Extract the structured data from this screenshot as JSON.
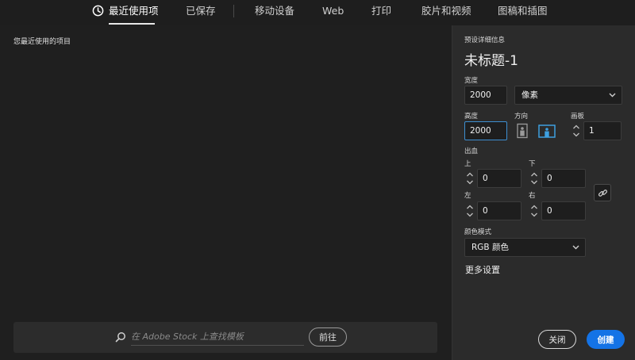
{
  "tabs": [
    {
      "label": "最近使用项",
      "active": true
    },
    {
      "label": "已保存"
    },
    {
      "label": "移动设备"
    },
    {
      "label": "Web"
    },
    {
      "label": "打印"
    },
    {
      "label": "胶片和视频"
    },
    {
      "label": "图稿和插图"
    }
  ],
  "left": {
    "title": "您最近使用的项目",
    "stock_placeholder": "在 Adobe Stock 上查找模板",
    "go_label": "前往"
  },
  "preset": {
    "section_label": "预设详细信息",
    "doc_name": "未标题-1",
    "width_label": "宽度",
    "width_value": "2000",
    "unit_value": "像素",
    "height_label": "高度",
    "height_value": "2000",
    "orientation_label": "方向",
    "artboard_label": "画板",
    "artboard_value": "1",
    "bleed_label": "出血",
    "top_label": "上",
    "top_value": "0",
    "bottom_label": "下",
    "bottom_value": "0",
    "left_label": "左",
    "left_value": "0",
    "right_label": "右",
    "right_value": "0",
    "color_mode_label": "颜色模式",
    "color_mode_value": "RGB 颜色",
    "more_settings": "更多设置",
    "close_label": "关闭",
    "create_label": "创建"
  },
  "colors": {
    "accent": "#1473e6",
    "focus": "#3d8fd1",
    "orientation_active": "#3ea0e0"
  },
  "icons": [
    "clock-icon",
    "search-icon",
    "chevron-down-icon",
    "portrait-icon",
    "landscape-icon",
    "link-icon",
    "stepper-icon"
  ]
}
